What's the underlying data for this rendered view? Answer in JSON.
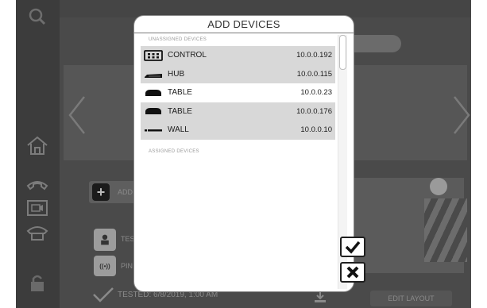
{
  "modal": {
    "title": "ADD DEVICES",
    "unassigned_label": "UNASSIGNED DEVICES",
    "assigned_label": "ASSIGNED DEVICES",
    "devices": [
      {
        "name": "CONTROL",
        "ip": "10.0.0.192",
        "icon": "control-panel-icon",
        "highlighted": true
      },
      {
        "name": "HUB",
        "ip": "10.0.0.115",
        "icon": "hub-icon",
        "highlighted": true
      },
      {
        "name": "TABLE",
        "ip": "10.0.0.23",
        "icon": "table-mic-icon",
        "highlighted": false
      },
      {
        "name": "TABLE",
        "ip": "10.0.0.176",
        "icon": "table-mic-icon",
        "highlighted": true
      },
      {
        "name": "WALL",
        "ip": "10.0.0.10",
        "icon": "wall-bar-icon",
        "highlighted": true
      }
    ]
  },
  "background": {
    "add_label": "ADD",
    "tested_label": "TES",
    "ping_label": "PIN",
    "tested_status": "TESTED: 6/8/2019, 1:00 AM",
    "edit_layout": "EDIT LAYOUT"
  },
  "colors": {
    "row_highlight": "#d8d8d8",
    "background_dim": "#4a4a4a",
    "modal_bg": "#ffffff"
  }
}
